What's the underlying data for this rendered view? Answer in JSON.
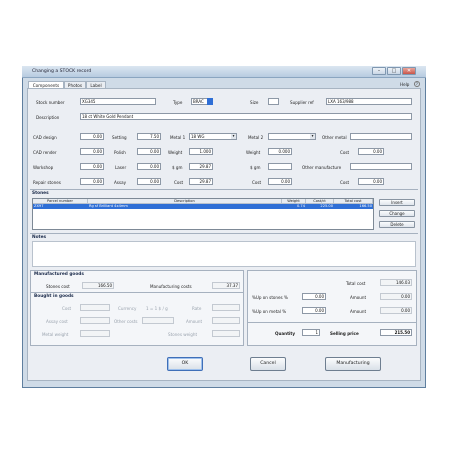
{
  "window": {
    "title": "Changing a STOCK record"
  },
  "tabs": [
    {
      "label": "Components"
    },
    {
      "label": "Photos"
    },
    {
      "label": "Label"
    }
  ],
  "help": {
    "label": "Help"
  },
  "header": {
    "stock_number_label": "Stock number",
    "stock_number": "XG345",
    "type_label": "Type",
    "type": "BRAC",
    "size_label": "Size",
    "size": "",
    "supplier_ref_label": "Supplier ref",
    "supplier_ref": "LXA 163/988",
    "description_label": "Description",
    "description": "18 ct White Gold Pendant"
  },
  "costs": {
    "cad_design_label": "CAD design",
    "cad_design": "0.00",
    "setting_label": "Setting",
    "setting": "7.50",
    "metal1_label": "Metal 1",
    "metal1": "18 WG",
    "metal2_label": "Metal 2",
    "metal2": "",
    "other_metal_label": "Other metal",
    "other_metal": "",
    "cad_render_label": "CAD render",
    "cad_render": "0.00",
    "polish_label": "Polish",
    "polish": "0.00",
    "weight1_label": "Weight",
    "weight1": "1.000",
    "weight2_label": "Weight",
    "weight2": "0.000",
    "cost_om_label": "Cost",
    "cost_om": "0.00",
    "workshop_label": "Workshop",
    "workshop": "0.00",
    "laser_label": "Laser",
    "laser": "0.00",
    "pgm1_label": "$ gm",
    "pgm1": "29.87",
    "pgm2_label": "$ gm",
    "pgm2": "",
    "other_manufacture_label": "Other manufacture",
    "other_manufacture": "",
    "repair_stones_label": "Repair stones",
    "repair_stones": "0.00",
    "assay_label": "Assay",
    "assay": "0.00",
    "cost1_label": "Cost",
    "cost1": "29.87",
    "cost2_label": "Cost",
    "cost2": "0.00",
    "cost_omf_label": "Cost",
    "cost_omf": "0.00"
  },
  "stones": {
    "heading": "Stones",
    "columns": [
      "Parcel number",
      "Description",
      "Weight",
      "Cost/ct",
      "Total cost"
    ],
    "rows": [
      [
        "ZX97",
        "Rg sf Brilliant 4x4mm",
        "0.74",
        "225.00",
        "166.50"
      ]
    ],
    "insert_label": "Insert",
    "change_label": "Change",
    "delete_label": "Delete"
  },
  "notes": {
    "heading": "Notes",
    "text": ""
  },
  "manufactured": {
    "heading": "Manufactured goods",
    "stones_cost_label": "Stones cost",
    "stones_cost": "166.50",
    "manufacturing_costs_label": "Manufacturing costs",
    "manufacturing_costs": "37.37"
  },
  "bought": {
    "heading": "Bought in goods",
    "cost_label": "Cost",
    "currency_label": "Currency",
    "rate_label": "Rate",
    "rate_text": "1 = 1 $ / g",
    "assay_cost_label": "Assay cost",
    "other_costs_label": "Other costs",
    "amount_label": "Amount",
    "metal_weight_label": "Metal weight",
    "stones_weight_label": "Stones weight"
  },
  "pricing": {
    "total_cost_label": "Total cost",
    "total_cost": "146.03",
    "markup_stones_label": "%Up on stones %",
    "markup_stones": "0.00",
    "amount1_label": "Amount",
    "amount1": "0.00",
    "markup_metal_label": "%Up on metal %",
    "markup_metal": "0.00",
    "amount2_label": "Amount",
    "amount2": "0.00",
    "quantity_label": "Quantity",
    "quantity": "1",
    "selling_price_label": "Selling price",
    "selling_price": "215.50"
  },
  "buttons": {
    "ok": "OK",
    "cancel": "Cancel",
    "manufacturing": "Manufacturing"
  }
}
